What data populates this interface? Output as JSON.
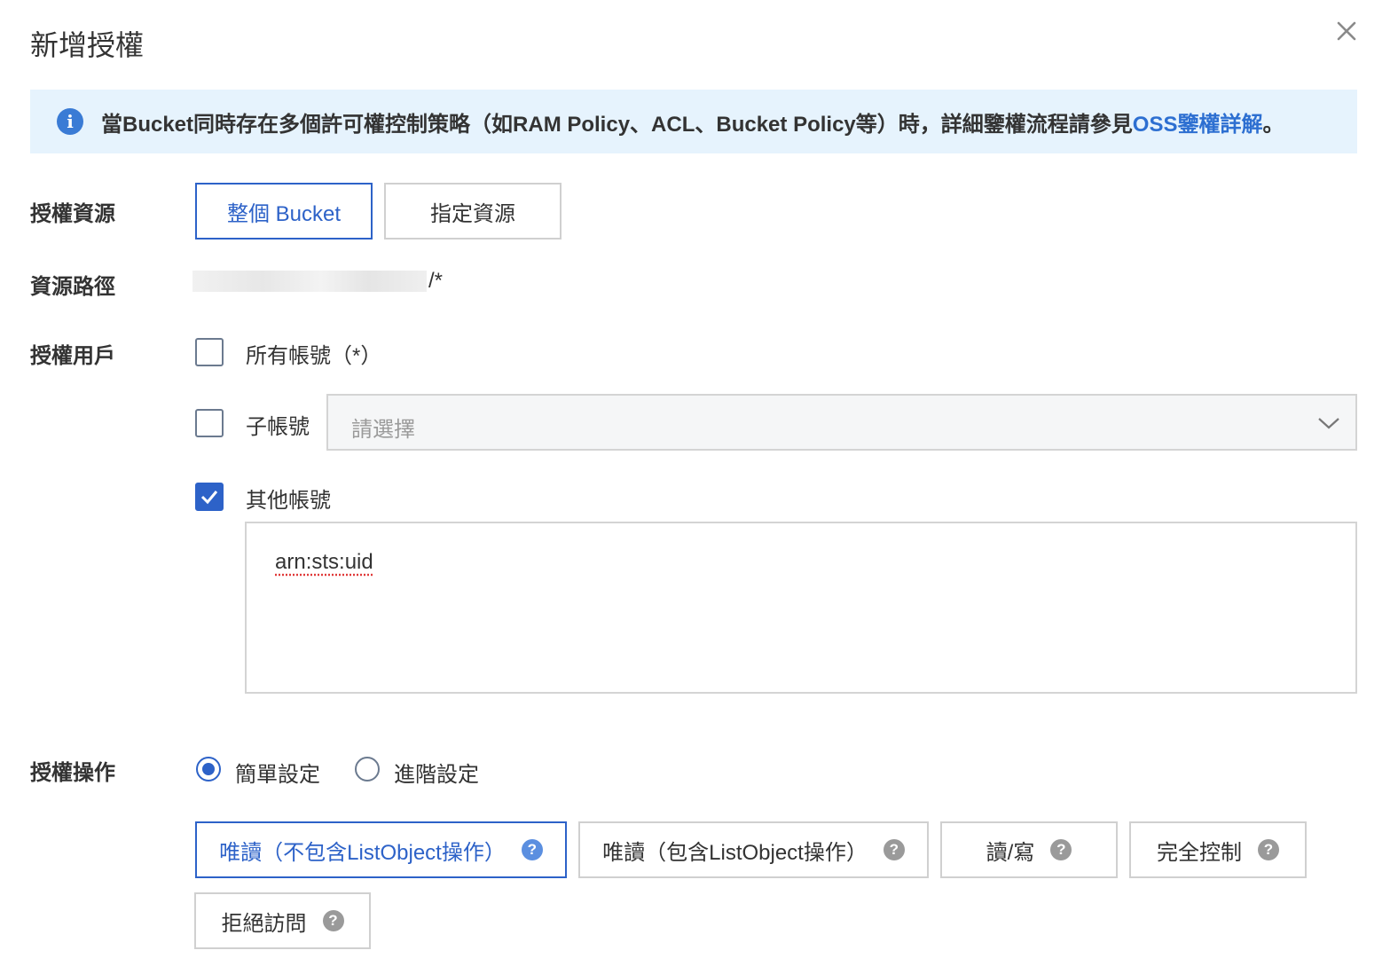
{
  "dialog": {
    "title": "新增授權"
  },
  "notice": {
    "text": "當Bucket同時存在多個許可權控制策略（如RAM Policy、ACL、Bucket Policy等）時，詳細鑒權流程請參見",
    "link": "OSS鑒權詳解",
    "suffix": "。"
  },
  "resource": {
    "label": "授權資源",
    "options": [
      "整個 Bucket",
      "指定資源"
    ],
    "selected": "整個 Bucket"
  },
  "path": {
    "label": "資源路徑",
    "suffix": "/*"
  },
  "users": {
    "label": "授權用戶",
    "all_accounts": {
      "label": "所有帳號（*）",
      "checked": false
    },
    "sub_accounts": {
      "label": "子帳號",
      "checked": false,
      "placeholder": "請選擇"
    },
    "other_accounts": {
      "label": "其他帳號",
      "checked": true,
      "value": "arn:sts:uid"
    }
  },
  "operation": {
    "label": "授權操作",
    "modes": [
      "簡單設定",
      "進階設定"
    ],
    "selected_mode": "簡單設定",
    "options": [
      "唯讀（不包含ListObject操作）",
      "唯讀（包含ListObject操作）",
      "讀/寫",
      "完全控制",
      "拒絕訪問"
    ],
    "selected": "唯讀（不包含ListObject操作）",
    "help_glyph": "?"
  },
  "icons": {
    "info": "i"
  },
  "colors": {
    "accent": "#2d62c8",
    "notice_bg": "#e6f3fd",
    "link": "#2d6fd1"
  }
}
